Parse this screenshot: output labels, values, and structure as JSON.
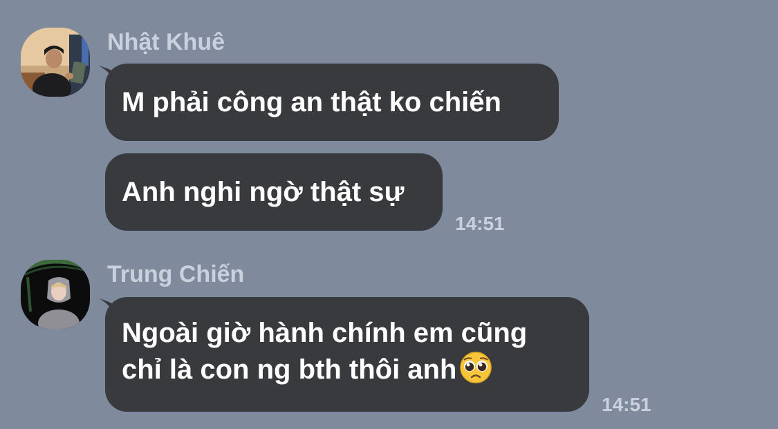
{
  "chat": {
    "messages_group_1": {
      "sender_name": "Nhật Khuê",
      "avatar_icon": "user-photo-avatar",
      "messages": [
        {
          "text": "M phải công an thật ko chiến"
        },
        {
          "text": "Anh nghi ngờ thật sự"
        }
      ],
      "time": "14:51"
    },
    "messages_group_2": {
      "sender_name": "Trung Chiến",
      "avatar_icon": "user-photo-avatar",
      "messages": [
        {
          "line1": "Ngoài giờ hành chính em cũng",
          "line2": "chỉ là con ng bth thôi anh",
          "emoji": "pleading-face-emoji"
        }
      ],
      "time": "14:51"
    }
  },
  "colors": {
    "background": "#7f8a9c",
    "bubble": "#393a3e",
    "bubble_text": "#ffffff",
    "meta_text": "#c9d1de"
  }
}
